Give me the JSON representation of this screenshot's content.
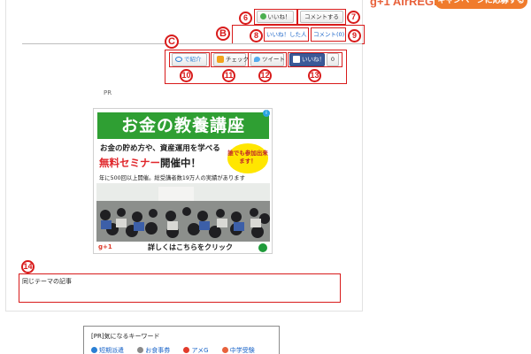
{
  "header_ad": {
    "logo_prefix": "g+1",
    "logo_text": "AirREGI",
    "button_label": "キャンペーンに応募する"
  },
  "buttons": {
    "like_label": "いいね！",
    "comment_label": "コメントする",
    "liked_by_label": "いいね！した人",
    "comment_count_label": "コメント(0)"
  },
  "share": {
    "introduce_label": "で紹介",
    "check_label": "チェック",
    "tweet_label": "ツイート",
    "fb_like_label": "いいね！",
    "fb_count": "0"
  },
  "annotations": {
    "b6": "6",
    "b7": "7",
    "b8": "8",
    "b9": "9",
    "bB": "B",
    "bC": "C",
    "b10": "10",
    "b11": "11",
    "b12": "12",
    "b13": "13",
    "b14": "14"
  },
  "pr_label": "PR",
  "ad": {
    "title": "お金の教養講座",
    "line1": "お金の貯め方や、資産運用を学べる",
    "line2_red": "無料セミナー",
    "line2_rest": "開催中！",
    "circle_text": "誰でも参加出来ます！",
    "line3": "年に500回以上開催。総受講者数19万人の実績があります",
    "footer_icon": "g+1",
    "cta": "詳しくはこちらをクリック"
  },
  "related": {
    "title": "同じテーマの記事"
  },
  "keywords": {
    "title": "[PR]気になるキーワード",
    "items": [
      "短期派遣",
      "お食事券",
      "アメG",
      "中学受験"
    ],
    "dot_colors": [
      "#2a7fd4",
      "#8a8a8a",
      "#e23b2b",
      "#e8623c"
    ]
  },
  "colors": {
    "annotation_red": "#d81b1b",
    "ad_green": "#2f9f33",
    "link_blue": "#1a64c8",
    "twitter_blue": "#55acee",
    "facebook_blue": "#3b5998"
  }
}
